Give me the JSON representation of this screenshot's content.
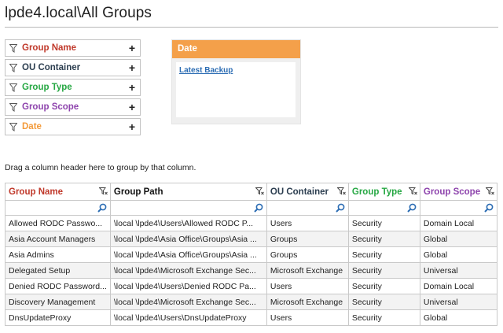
{
  "page": {
    "title": "lpde4.local\\All Groups"
  },
  "filters": [
    {
      "label": "Group Name",
      "color": "#c0392b"
    },
    {
      "label": "OU Container",
      "color": "#2c3e50"
    },
    {
      "label": "Group Type",
      "color": "#27a844"
    },
    {
      "label": "Group Scope",
      "color": "#8e44ad"
    },
    {
      "label": "Date",
      "color": "#f39a3a"
    }
  ],
  "filter_add_glyph": "+",
  "date_panel": {
    "header": "Date",
    "link": "Latest Backup",
    "accent": "#f4a04a"
  },
  "group_hint": "Drag a column header here to group by that column.",
  "table": {
    "columns": [
      {
        "label": "Group Name",
        "color": "#c0392b"
      },
      {
        "label": "Group Path",
        "color": "#111111"
      },
      {
        "label": "OU Container",
        "color": "#2c3e50"
      },
      {
        "label": "Group Type",
        "color": "#27a844"
      },
      {
        "label": "Group Scope",
        "color": "#8e44ad"
      }
    ],
    "rows": [
      [
        "Allowed RODC Passwo...",
        "\\local \\lpde4\\Users\\Allowed RODC P...",
        "Users",
        "Security",
        "Domain Local"
      ],
      [
        "Asia Account Managers",
        "\\local \\lpde4\\Asia Office\\Groups\\Asia ...",
        "Groups",
        "Security",
        "Global"
      ],
      [
        "Asia Admins",
        "\\local \\lpde4\\Asia Office\\Groups\\Asia ...",
        "Groups",
        "Security",
        "Global"
      ],
      [
        "Delegated Setup",
        "\\local \\lpde4\\Microsoft Exchange Sec...",
        "Microsoft Exchange",
        "Security",
        "Universal"
      ],
      [
        "Denied RODC Password...",
        "\\local \\lpde4\\Users\\Denied RODC Pa...",
        "Users",
        "Security",
        "Domain Local"
      ],
      [
        "Discovery Management",
        "\\local \\lpde4\\Microsoft Exchange Sec...",
        "Microsoft Exchange",
        "Security",
        "Universal"
      ],
      [
        "DnsUpdateProxy",
        "\\local \\lpde4\\Users\\DnsUpdateProxy",
        "Users",
        "Security",
        "Global"
      ]
    ]
  },
  "icons": {
    "filter": "funnel-icon",
    "search": "magnifier-icon",
    "add": "plus-icon",
    "accent_search": "#2b6cb3"
  }
}
